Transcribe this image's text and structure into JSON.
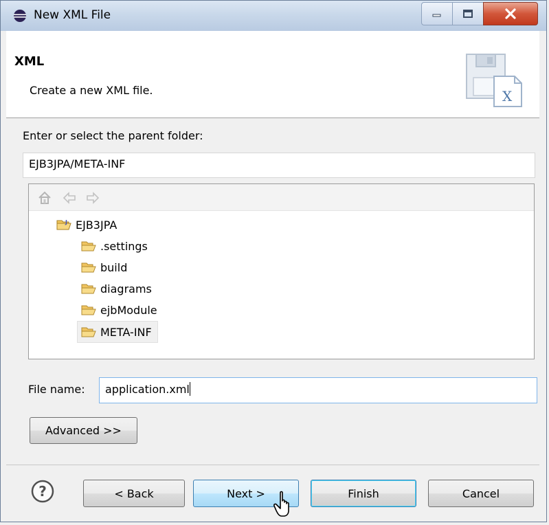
{
  "window": {
    "title": "New XML File"
  },
  "banner": {
    "heading": "XML",
    "description": "Create a new XML file."
  },
  "parent_folder": {
    "label": "Enter or select the parent folder:",
    "value": "EJB3JPA/META-INF"
  },
  "tree": {
    "toolbar_icons": [
      "home-icon",
      "back-arrow-icon",
      "forward-arrow-icon"
    ],
    "project": "EJB3JPA",
    "folders": [
      ".settings",
      "build",
      "diagrams",
      "ejbModule",
      "META-INF"
    ],
    "selected": "META-INF"
  },
  "file_name": {
    "label": "File name:",
    "value": "application.xml"
  },
  "buttons": {
    "advanced": "Advanced >>",
    "back": "< Back",
    "next": "Next >",
    "finish": "Finish",
    "cancel": "Cancel"
  },
  "colors": {
    "title_bar": "#c9d8ea",
    "close_button": "#d2563a",
    "focus_border": "#7eb4ea",
    "folder": "#e8b84a"
  }
}
